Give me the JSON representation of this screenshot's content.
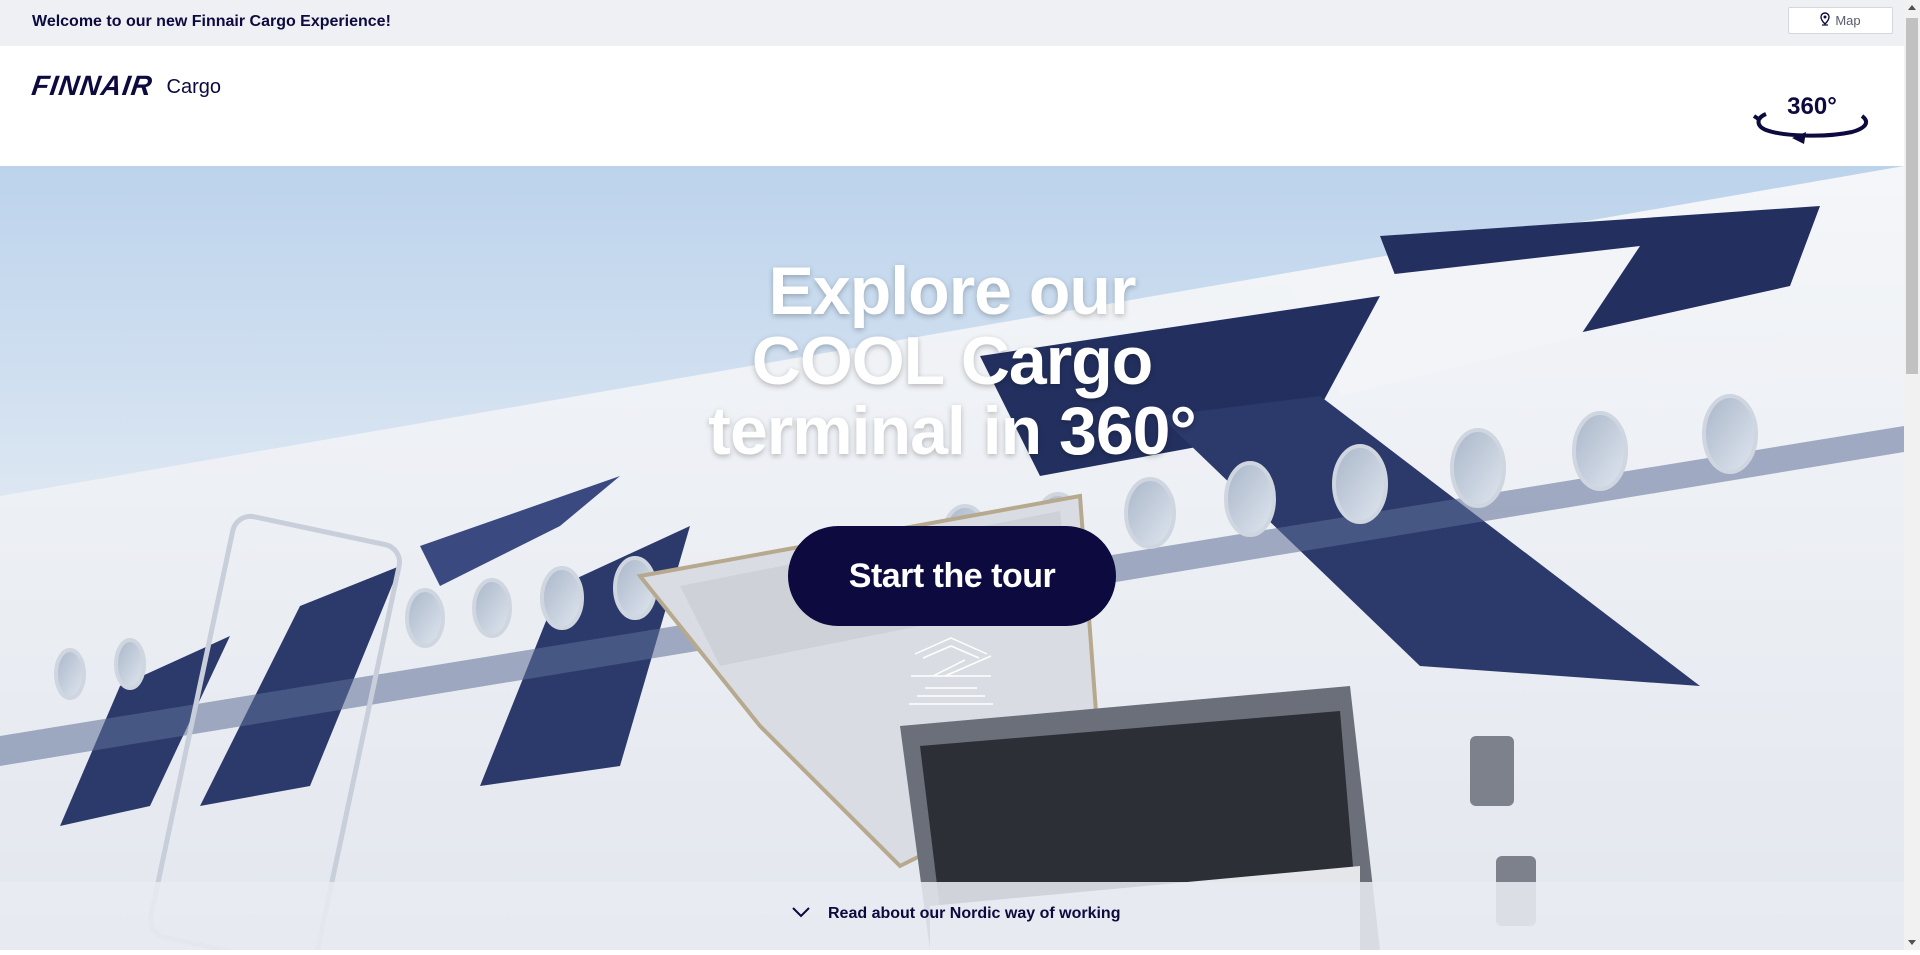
{
  "topbar": {
    "welcome": "Welcome to our new Finnair Cargo Experience!",
    "map_label": "Map"
  },
  "header": {
    "logo_word": "FINNAIR",
    "logo_suffix": "Cargo",
    "badge_label": "360°"
  },
  "hero": {
    "headline_lines": [
      "Explore our",
      "COOL Cargo",
      "terminal in 360°"
    ],
    "cta_label": "Start the tour"
  },
  "footer": {
    "read_more_label": "Read about our Nordic way of working"
  },
  "icons": {
    "map": "map-pin-icon",
    "badge": "rotate-360-icon",
    "tour": "tour-arrow-icon",
    "chevron": "chevron-down-icon"
  },
  "colors": {
    "brand_navy": "#0c0a3e",
    "topbar_bg": "#eef0f4",
    "cta_bg": "#0c0a3e"
  }
}
